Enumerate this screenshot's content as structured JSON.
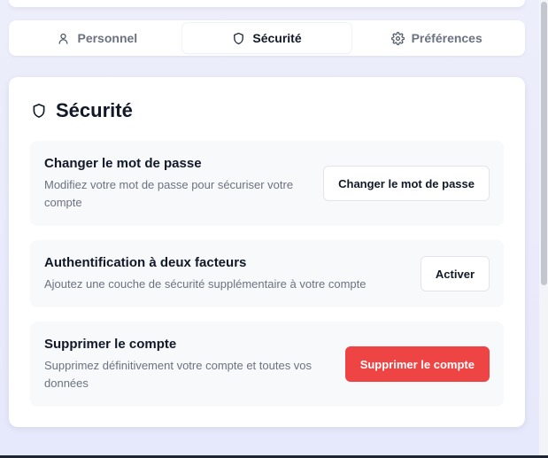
{
  "tabs": [
    {
      "label": "Personnel",
      "icon": "user-icon",
      "active": false
    },
    {
      "label": "Sécurité",
      "icon": "shield-icon",
      "active": true
    },
    {
      "label": "Préférences",
      "icon": "gear-icon",
      "active": false
    }
  ],
  "card": {
    "title": "Sécurité",
    "icon": "shield-icon"
  },
  "settings": [
    {
      "title": "Changer le mot de passe",
      "desc_line1": "Modifiez votre mot de passe pour sécuriser votre",
      "desc_line2": "compte",
      "button": "Changer le mot de passe"
    },
    {
      "title": "Authentification à deux facteurs",
      "desc_line1": "Ajoutez une couche de sécurité supplémentaire à votre compte",
      "button": "Activer"
    },
    {
      "title": "Supprimer le compte",
      "desc_line1": "Supprimez définitivement votre compte et toutes vos",
      "desc_line2": "données",
      "button": "Supprimer le compte"
    }
  ],
  "colors": {
    "danger": "#ef4444",
    "background": "#eceefb",
    "card": "#ffffff",
    "row": "#f8f9fb"
  }
}
